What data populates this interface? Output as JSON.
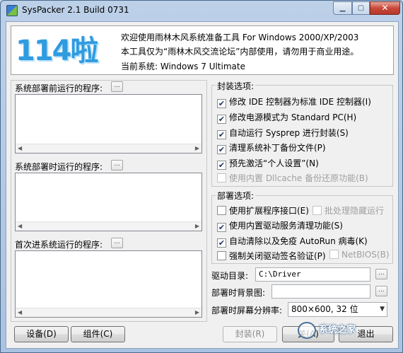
{
  "window": {
    "title": "SysPacker 2.1 Build 0731"
  },
  "banner": {
    "logo_text": "114啦",
    "line1": "欢迎使用雨林木风系统准备工具 For Windows 2000/XP/2003",
    "line2": "本工具仅为“雨林木风交流论坛”内部使用，请勿用于商业用途。",
    "line3": "当前系统: Windows 7 Ultimate"
  },
  "left": {
    "pre_label": "系统部署前运行的程序:",
    "during_label": "系统部署时运行的程序:",
    "first_label": "首次进系统运行的程序:",
    "browse": "..."
  },
  "pack_options": {
    "title": "封装选项:",
    "items": [
      {
        "label": "修改 IDE 控制器为标准 IDE 控制器(I)",
        "checked": true,
        "disabled": false
      },
      {
        "label": "修改电源模式为 Standard PC(H)",
        "checked": true,
        "disabled": false
      },
      {
        "label": "自动运行 Sysprep 进行封装(S)",
        "checked": true,
        "disabled": false
      },
      {
        "label": "清理系统补丁备份文件(P)",
        "checked": true,
        "disabled": false
      },
      {
        "label": "预先激活“个人设置”(N)",
        "checked": true,
        "disabled": false
      },
      {
        "label": "使用内置 Dllcache 备份还原功能(B)",
        "checked": false,
        "disabled": true
      }
    ]
  },
  "deploy_options": {
    "title": "部署选项:",
    "ext_api": {
      "label": "使用扩展程序接口(E)",
      "checked": false,
      "disabled": false
    },
    "batch_hide": {
      "label": "批处理隐藏运行",
      "checked": false,
      "disabled": true
    },
    "driver_clean": {
      "label": "使用内置驱动服务清理功能(S)",
      "checked": true,
      "disabled": false
    },
    "autorun": {
      "label": "自动清除以及免疫 AutoRun 病毒(K)",
      "checked": true,
      "disabled": false
    },
    "force_sign": {
      "label": "强制关闭驱动签名验证(P)",
      "checked": false,
      "disabled": false
    },
    "netbios": {
      "label": "NetBIOS(B)",
      "checked": false,
      "disabled": true
    }
  },
  "fields": {
    "driver_dir_label": "驱动目录:",
    "driver_dir_value": "C:\\Driver",
    "bg_label": "部署时背景图:",
    "bg_value": "",
    "res_label": "部署时屏幕分辨率:",
    "res_value": "800×600, 32 位"
  },
  "buttons": {
    "settings": "设备(D)",
    "components": "组件(C)",
    "pack": "封装(R)",
    "about": "关(A)",
    "exit": "退出"
  },
  "watermark": "系统之家",
  "check_mark": "✔"
}
